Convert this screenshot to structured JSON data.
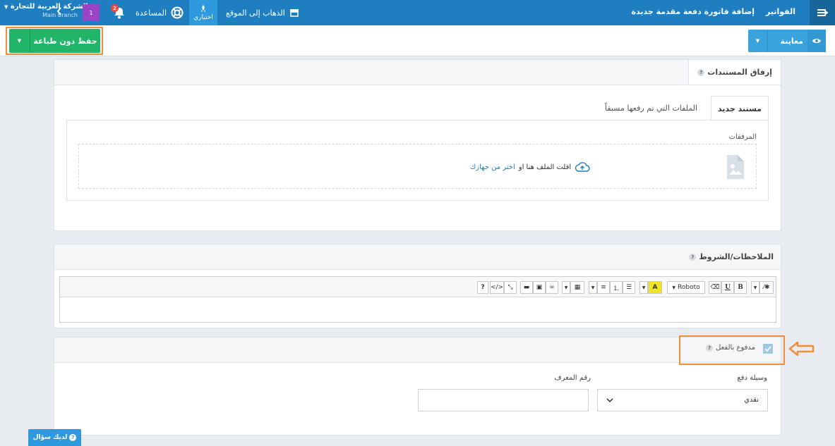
{
  "topbar": {
    "breadcrumb_root": "الفواتير",
    "breadcrumb_current": "إضافة فاتورة دفعة مقدمة جديدة",
    "go_to_site": "الذهاب إلى الموقع",
    "shortcuts": "اختياري",
    "help": "المساعدة",
    "notifications_count": "2",
    "company_name": "الشركة العربية للتجارة",
    "branch": "Main Branch",
    "avatar_text": "1"
  },
  "actions": {
    "save_label": "حفظ دون طباعة",
    "preview_label": "معاينة"
  },
  "attachments": {
    "title": "إرفاق المستندات",
    "tab_new": "مستند جديد",
    "tab_uploaded": "الملفات التي تم رفعها مسبقاً",
    "attachments_label": "المرفقات",
    "drop_text": "افلت الملف هنا او",
    "choose_text": "اختر من جهازك"
  },
  "notes": {
    "title": "الملاحظات/الشروط",
    "font_name": "Roboto"
  },
  "payment": {
    "paid_label": "مدفوع بالفعل",
    "method_label": "وسيلة دفع",
    "method_value": "نقدي",
    "reference_label": "رقم المعرف",
    "reference_value": ""
  },
  "help_widget": {
    "label": "لديك سؤال"
  },
  "colors": {
    "topbar": "#1f7ec0",
    "save": "#21b56a",
    "preview": "#3aa3dc",
    "highlight": "#f08e3a"
  }
}
